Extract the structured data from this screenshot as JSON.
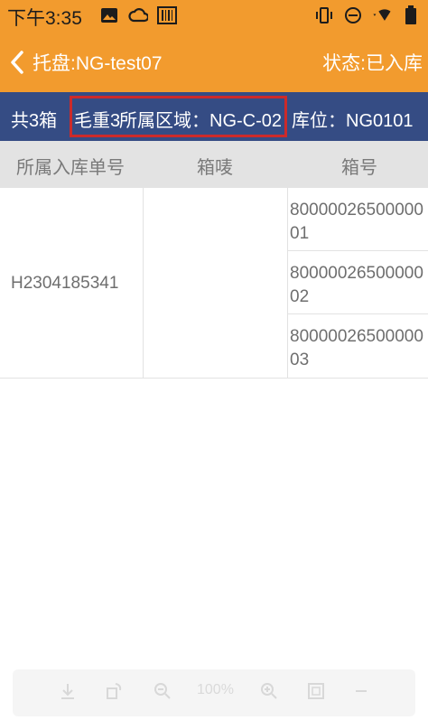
{
  "status_bar": {
    "time": "下午3:35",
    "icons_left": [
      "image-icon",
      "cloud-sync-icon",
      "barcode-icon"
    ],
    "icons_right": [
      "vibrate-icon",
      "dnd-icon",
      "wifi-icon",
      "battery-icon"
    ]
  },
  "app_bar": {
    "title": "托盘:NG-test07",
    "status": "状态:已入库"
  },
  "summary": {
    "count": "共3箱",
    "weight": "毛重3",
    "area": "所属区域：NG-C-02",
    "location": "库位：NG0101"
  },
  "table": {
    "headers": [
      "所属入库单号",
      "箱唛",
      "箱号"
    ],
    "order_no": "H2304185341",
    "mark": "",
    "boxes": [
      "8000002650000001",
      "8000002650000002",
      "8000002650000003"
    ]
  },
  "pdf_toolbar": {
    "zoom": "100%"
  },
  "colors": {
    "accent": "#f29b2e",
    "summary_bg": "#354c84",
    "highlight": "#cc2a2a"
  }
}
